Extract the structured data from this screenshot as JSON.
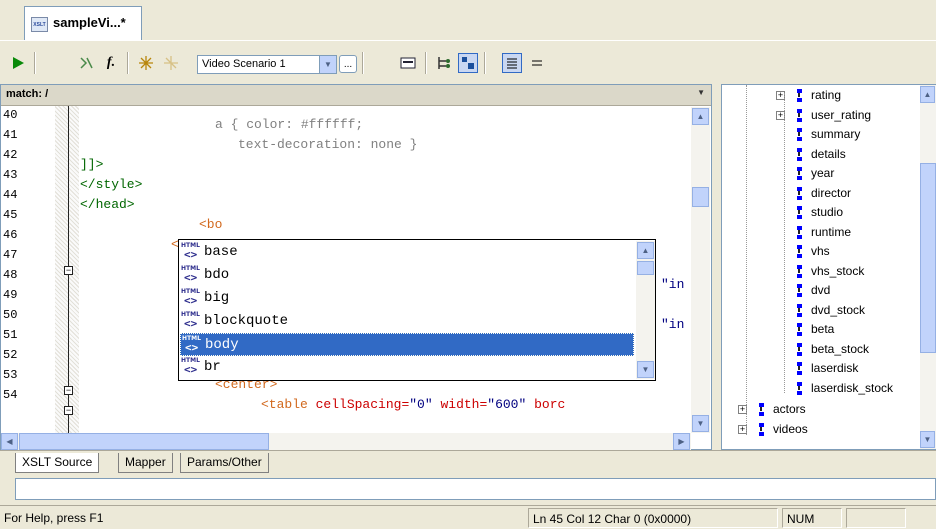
{
  "document_tab": {
    "title": "sampleVi...*",
    "icon": "xslt-file-icon"
  },
  "toolbar": {
    "scenario_value": "Video Scenario 1",
    "browse_label": "...",
    "buttons": [
      "run-icon",
      "xpath-icon",
      "function-icon",
      "breakpoint-icon",
      "clear-breakpoint-icon",
      "browse-icon",
      "output-icon",
      "tree-view-icon",
      "toggle-panel-icon",
      "text-view-icon",
      "menu-icon"
    ]
  },
  "editor": {
    "match": "match: /",
    "line_numbers": [
      "40",
      "41",
      "42",
      "43",
      "44",
      "45",
      "46",
      "47",
      "48",
      "49",
      "50",
      "51",
      "52",
      "53",
      "54"
    ],
    "lines": {
      "l40": "a { color: #ffffff;",
      "l41": "text-decoration: none }",
      "l42": "]]>",
      "l43": "</style>",
      "l44": "</head>",
      "l45": "<bo",
      "l46": "<",
      "l48_tail": "\"in",
      "l50_tail": "\"in",
      "l53": "<center>",
      "l54_tag": "<table",
      "l54_attr1": "cellSpacing=",
      "l54_val1": "\"0\"",
      "l54_attr2": "width=",
      "l54_val2": "\"600\"",
      "l54_attr3": "borc"
    }
  },
  "autocomplete": {
    "icon_text": "HTML",
    "items": [
      {
        "label": "base",
        "selected": false
      },
      {
        "label": "bdo",
        "selected": false
      },
      {
        "label": "big",
        "selected": false
      },
      {
        "label": "blockquote",
        "selected": false
      },
      {
        "label": "body",
        "selected": true
      },
      {
        "label": "br",
        "selected": false
      }
    ]
  },
  "tree": {
    "nodes": [
      {
        "label": "rating",
        "expandable": true
      },
      {
        "label": "user_rating",
        "expandable": true
      },
      {
        "label": "summary",
        "expandable": false
      },
      {
        "label": "details",
        "expandable": false
      },
      {
        "label": "year",
        "expandable": false
      },
      {
        "label": "director",
        "expandable": false
      },
      {
        "label": "studio",
        "expandable": false
      },
      {
        "label": "runtime",
        "expandable": false
      },
      {
        "label": "vhs",
        "expandable": false
      },
      {
        "label": "vhs_stock",
        "expandable": false
      },
      {
        "label": "dvd",
        "expandable": false
      },
      {
        "label": "dvd_stock",
        "expandable": false
      },
      {
        "label": "beta",
        "expandable": false
      },
      {
        "label": "beta_stock",
        "expandable": false
      },
      {
        "label": "laserdisk",
        "expandable": false
      },
      {
        "label": "laserdisk_stock",
        "expandable": false
      },
      {
        "label": "actors",
        "expandable": true
      },
      {
        "label": "videos",
        "expandable": true
      }
    ]
  },
  "bottom_tabs": [
    "XSLT Source",
    "Mapper",
    "Params/Other"
  ],
  "status": {
    "help": "For Help, press F1",
    "position": "Ln 45 Col 12  Char 0 (0x0000)",
    "num": "NUM"
  },
  "colors": {
    "selection": "#316ac5",
    "tag": "#006600",
    "attribute": "#cc0000",
    "css": "#808080"
  }
}
